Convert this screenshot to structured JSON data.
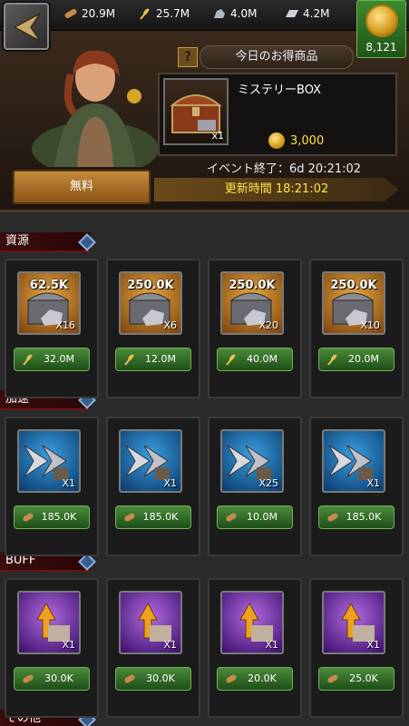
{
  "resources": [
    {
      "icon": "wood-log-icon",
      "value": "20.9M"
    },
    {
      "icon": "wheat-icon",
      "value": "25.7M"
    },
    {
      "icon": "stone-ore-icon",
      "value": "4.0M"
    },
    {
      "icon": "iron-bar-icon",
      "value": "4.2M"
    }
  ],
  "gold": {
    "icon": "gold-coin-icon",
    "amount": "8,121"
  },
  "deal": {
    "title": "今日のお得商品",
    "help": "?",
    "item_name": "ミステリーBOX",
    "item_qty": "x1",
    "price": "3,000",
    "event_end": "イベント終了：6d 20:21:02",
    "free_button": "無料",
    "refresh": "更新時間 18:21:02"
  },
  "sections": {
    "resources": {
      "label": "資源",
      "items": [
        {
          "amount": "62.5K",
          "qty": "X16",
          "price": "32.0M",
          "price_icon": "wheat-icon",
          "kind": "wood-chest-icon"
        },
        {
          "amount": "250.0K",
          "qty": "X6",
          "price": "12.0M",
          "price_icon": "wheat-icon",
          "kind": "stone-chest-icon"
        },
        {
          "amount": "250.0K",
          "qty": "X20",
          "price": "40.0M",
          "price_icon": "wheat-icon",
          "kind": "ore-chest-icon"
        },
        {
          "amount": "250.0K",
          "qty": "X10",
          "price": "20.0M",
          "price_icon": "wheat-icon",
          "kind": "iron-chest-icon"
        }
      ]
    },
    "speedup": {
      "label": "加速",
      "items": [
        {
          "qty": "X1",
          "price": "185.0K",
          "price_icon": "wood-log-icon",
          "kind": "heal-speedup-icon"
        },
        {
          "qty": "X1",
          "price": "185.0K",
          "price_icon": "wood-log-icon",
          "kind": "build-speedup-icon"
        },
        {
          "qty": "X25",
          "price": "10.0M",
          "price_icon": "wood-log-icon",
          "kind": "general-speedup-icon"
        },
        {
          "qty": "X1",
          "price": "185.0K",
          "price_icon": "wood-log-icon",
          "kind": "train-speedup-icon"
        }
      ]
    },
    "buff": {
      "label": "BUFF",
      "items": [
        {
          "qty": "X1",
          "price": "30.0K",
          "price_icon": "wood-log-icon",
          "kind": "wood-boost-icon"
        },
        {
          "qty": "X1",
          "price": "30.0K",
          "price_icon": "wood-log-icon",
          "kind": "wheat-boost-icon"
        },
        {
          "qty": "X1",
          "price": "20.0K",
          "price_icon": "wood-log-icon",
          "kind": "ore-boost-icon"
        },
        {
          "qty": "X1",
          "price": "25.0K",
          "price_icon": "wood-log-icon",
          "kind": "iron-boost-icon"
        }
      ]
    },
    "other": {
      "label": "その他"
    }
  }
}
